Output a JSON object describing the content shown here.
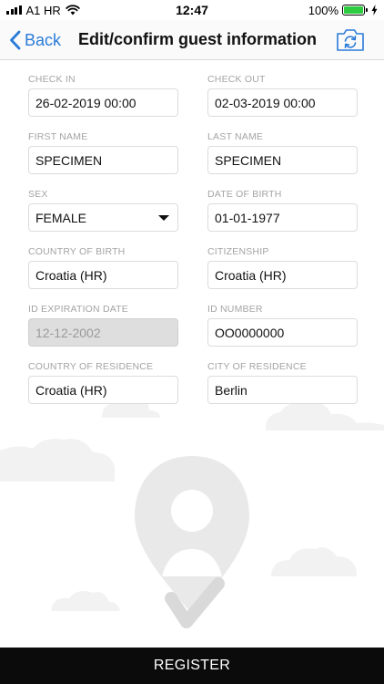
{
  "status_bar": {
    "carrier": "A1 HR",
    "time": "12:47",
    "battery": "100%"
  },
  "nav": {
    "back_label": "Back",
    "title": "Edit/confirm guest information"
  },
  "fields": {
    "check_in": {
      "label": "CHECK IN",
      "value": "26-02-2019 00:00"
    },
    "check_out": {
      "label": "CHECK OUT",
      "value": "02-03-2019 00:00"
    },
    "first_name": {
      "label": "FIRST NAME",
      "value": "SPECIMEN"
    },
    "last_name": {
      "label": "LAST NAME",
      "value": "SPECIMEN"
    },
    "sex": {
      "label": "SEX",
      "value": "FEMALE"
    },
    "date_of_birth": {
      "label": "DATE OF BIRTH",
      "value": "01-01-1977"
    },
    "country_of_birth": {
      "label": "COUNTRY OF BIRTH",
      "value": "Croatia (HR)"
    },
    "citizenship": {
      "label": "CITIZENSHIP",
      "value": "Croatia (HR)"
    },
    "id_expiration_date": {
      "label": "ID EXPIRATION DATE",
      "value": "12-12-2002"
    },
    "id_number": {
      "label": "ID NUMBER",
      "value": "OO0000000"
    },
    "country_of_residence": {
      "label": "COUNTRY OF RESIDENCE",
      "value": "Croatia (HR)"
    },
    "city_of_residence": {
      "label": "CITY OF RESIDENCE",
      "value": "Berlin"
    }
  },
  "register_label": "REGISTER",
  "icons": {
    "back": "chevron-left-icon",
    "camera": "camera-rotate-icon",
    "wifi": "wifi-icon",
    "battery": "battery-icon",
    "charging": "bolt-icon"
  },
  "colors": {
    "accent": "#2a7bd8",
    "battery_fill": "#2ecc40",
    "register_bg": "#0b0b0b"
  }
}
